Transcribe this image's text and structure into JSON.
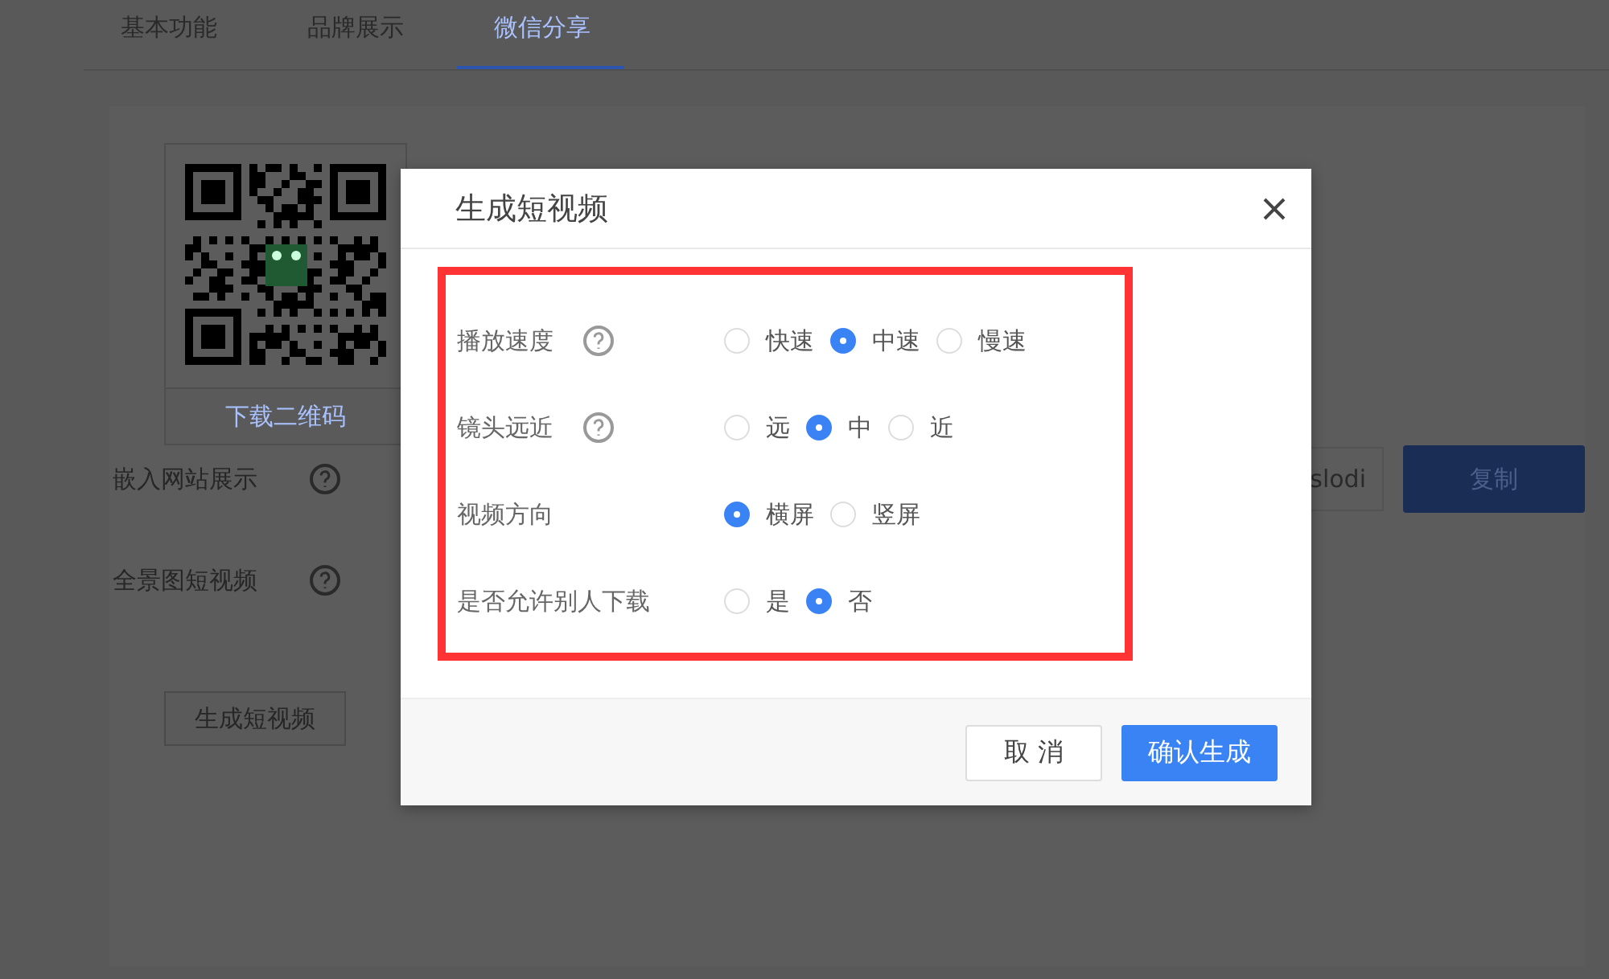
{
  "tabs": [
    {
      "label": "基本功能",
      "selected": false
    },
    {
      "label": "品牌展示",
      "selected": false
    },
    {
      "label": "微信分享",
      "selected": true
    }
  ],
  "qr_panel": {
    "download_button": "下载二维码"
  },
  "settings": [
    {
      "label": "嵌入网站展示",
      "help": true,
      "value": "slodi",
      "button": "复制"
    },
    {
      "label": "全景图短视频",
      "help": true
    }
  ],
  "generate_button": "生成短视频",
  "dialog": {
    "title": "生成短视频",
    "highlighted": true,
    "options": [
      {
        "label": "播放速度",
        "help": true,
        "kind": "radio",
        "choices": [
          {
            "label": "快速",
            "selected": false
          },
          {
            "label": "中速",
            "selected": true
          },
          {
            "label": "慢速",
            "selected": false
          }
        ]
      },
      {
        "label": "镜头远近",
        "help": true,
        "kind": "radio",
        "choices": [
          {
            "label": "远",
            "selected": false
          },
          {
            "label": "中",
            "selected": true
          },
          {
            "label": "近",
            "selected": false
          }
        ]
      },
      {
        "label": "视频方向",
        "help": false,
        "kind": "radio",
        "choices": [
          {
            "label": "横屏",
            "selected": true
          },
          {
            "label": "竖屏",
            "selected": false
          }
        ]
      },
      {
        "label": "是否允许别人下载",
        "help": false,
        "kind": "radio",
        "choices": [
          {
            "label": "是",
            "selected": false
          },
          {
            "label": "否",
            "selected": true
          }
        ]
      }
    ],
    "buttons": [
      {
        "label": "取 消",
        "kind": "secondary"
      },
      {
        "label": "确认生成",
        "kind": "primary"
      }
    ]
  }
}
